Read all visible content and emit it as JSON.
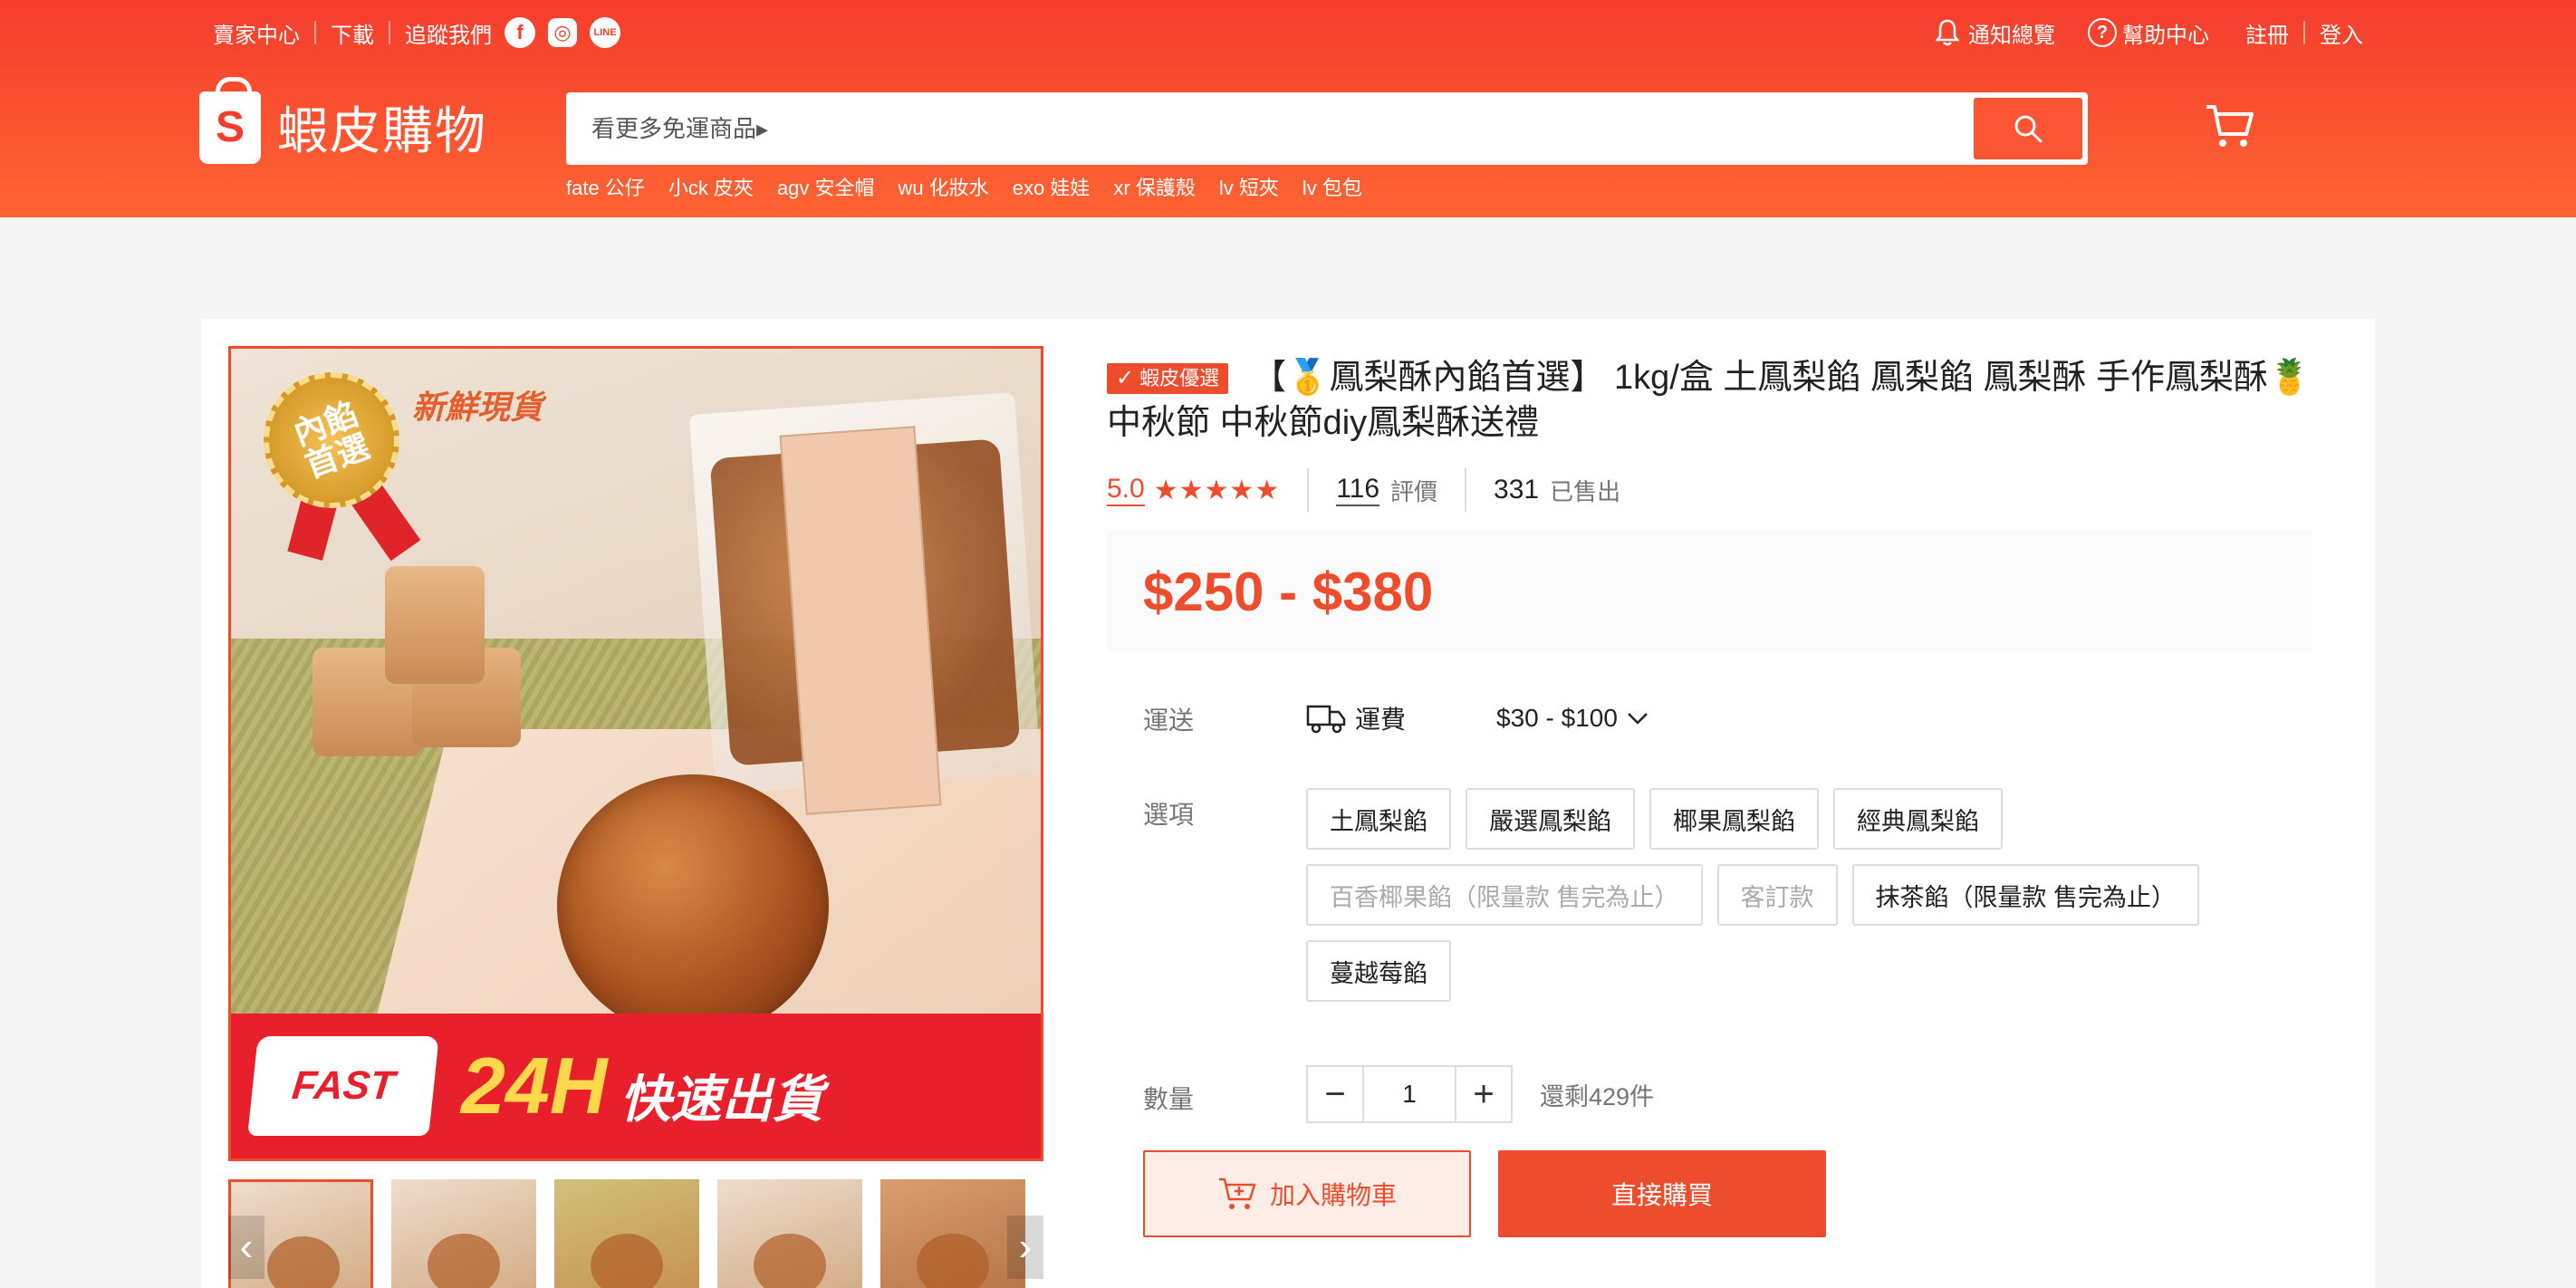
{
  "topbar": {
    "seller_center": "賣家中心",
    "download": "下載",
    "follow_us": "追蹤我們",
    "notifications": "通知總覽",
    "help_center": "幫助中心",
    "signup": "註冊",
    "login": "登入"
  },
  "logo": {
    "mark": "S",
    "text": "蝦皮購物"
  },
  "search": {
    "placeholder": "看更多免運商品▸"
  },
  "hotwords": [
    "fate 公仔",
    "小ck 皮夾",
    "agv 安全帽",
    "wu 化妝水",
    "exo 娃娃",
    "xr 保護殼",
    "lv 短夾",
    "lv 包包"
  ],
  "image": {
    "medal_text": "內餡首選",
    "fresh_text": "新鮮現貨",
    "fast_text": "FAST",
    "hours_text": "24H",
    "quick_text": "快速出貨"
  },
  "product": {
    "badge": "蝦皮優選",
    "title": "【🥇鳳梨酥內餡首選】 1kg/盒 土鳳梨餡 鳳梨餡 鳳梨酥 手作鳳梨酥🍍中秋節 中秋節diy鳳梨酥送禮",
    "rating": "5.0",
    "stars": "★★★★★",
    "reviews_count": "116",
    "reviews_label": "評價",
    "sold_count": "331",
    "sold_label": "已售出",
    "price": "$250 - $380"
  },
  "shipping": {
    "label": "運送",
    "fee_label": "運費",
    "fee_range": "$30 - $100"
  },
  "options": {
    "label": "選項",
    "items": [
      {
        "name": "土鳳梨餡",
        "disabled": false
      },
      {
        "name": "嚴選鳳梨餡",
        "disabled": false
      },
      {
        "name": "椰果鳳梨餡",
        "disabled": false
      },
      {
        "name": "經典鳳梨餡",
        "disabled": false
      },
      {
        "name": "百香椰果餡（限量款 售完為止）",
        "disabled": true
      },
      {
        "name": "客訂款",
        "disabled": true
      },
      {
        "name": "抹茶餡（限量款 售完為止）",
        "disabled": false
      },
      {
        "name": "蔓越莓餡",
        "disabled": false
      }
    ]
  },
  "quantity": {
    "label": "數量",
    "value": "1",
    "stock": "還剩429件"
  },
  "actions": {
    "add_to_cart": "加入購物車",
    "buy_now": "直接購買"
  },
  "colors": {
    "brand": "#ee4d2d",
    "header_top": "#f53d2d",
    "header_bottom": "#fe6433"
  }
}
